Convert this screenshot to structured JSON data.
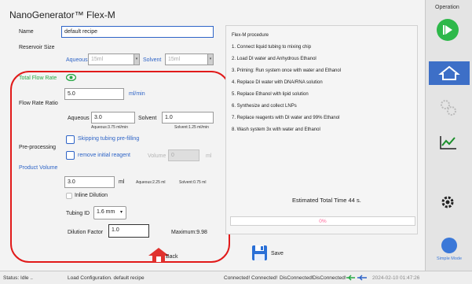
{
  "app": {
    "title": "NanoGenerator™ Flex-M"
  },
  "form": {
    "name_label": "Name",
    "name_value": "default recipe",
    "reservoir_label": "Reservoir Size",
    "aqueous_label": "Aqueous",
    "aqueous_value": "15ml",
    "solvent_label": "Solvent",
    "solvent_value": "15ml",
    "total_flow_label": "Total Flow Rate",
    "total_flow_value": "5.0",
    "total_flow_unit": "ml/min",
    "flow_ratio_label": "Flow Rate Ratio",
    "ratio_aqueous_label": "Aqueous",
    "ratio_aqueous_value": "3.0",
    "ratio_solvent_label": "Solvent",
    "ratio_solvent_value": "1.0",
    "aqueous_rate_note": "Aqueous:3.75 ml/min",
    "solvent_rate_note": "Solvent:1.25 ml/min",
    "preprocessing_label": "Pre-processing",
    "skip_tubing_label": "Skipping tubing pre-filling",
    "remove_reagent_label": "remove initial reagent",
    "volume_label": "Volume",
    "volume_value": "0",
    "volume_unit": "ml",
    "product_volume_label": "Product Volume",
    "product_volume_value": "3.0",
    "product_volume_unit": "ml",
    "product_aqueous_note": "Aqueous:2.25 ml",
    "product_solvent_note": "Solvent:0.75 ml",
    "inline_dilution_label": "Inline Dilution",
    "tubing_id_label": "Tubing ID",
    "tubing_id_value": "1.6 mm",
    "dilution_factor_label": "Dilution Factor",
    "dilution_factor_value": "1.0",
    "maximum_label": "Maximum:9.98"
  },
  "procedure": {
    "title": "Flex-M procedure",
    "steps": [
      "1.  Connect liquid tubing to mixing chip",
      "2.  Load DI water and Anhydrous Ethanol",
      "3.  Priming: Run system once with water and Ethanol",
      "4.  Replace DI water with DNA/RNA solution",
      "5.  Replace Ethanol with lipid solution",
      "6.  Synthesize and collect LNPs",
      "7.  Replace reagents with DI water and 99% Ethanol",
      "8.  Wash system 3x with water and Ethanol"
    ],
    "estimated_time": "Estimated Total Time 44 s.",
    "progress_text": "0%",
    "progress_value": 0
  },
  "buttons": {
    "back": "Back",
    "save": "Save"
  },
  "sidebar": {
    "header": "Operation",
    "simple_mode": "Simple Mode"
  },
  "status": {
    "idle": "Status: Idle ..",
    "message": "Load Configuration. default recipe",
    "connections": [
      "Connected!",
      "Connected!",
      "DisConnected!",
      "DisConnected!"
    ],
    "timestamp": "2024-02-10 01:47:26"
  },
  "colors": {
    "accent_blue": "#2e64c7",
    "highlight_red": "#e11a1a",
    "progress_pink": "#ff6699",
    "ok_green": "#27a844"
  }
}
